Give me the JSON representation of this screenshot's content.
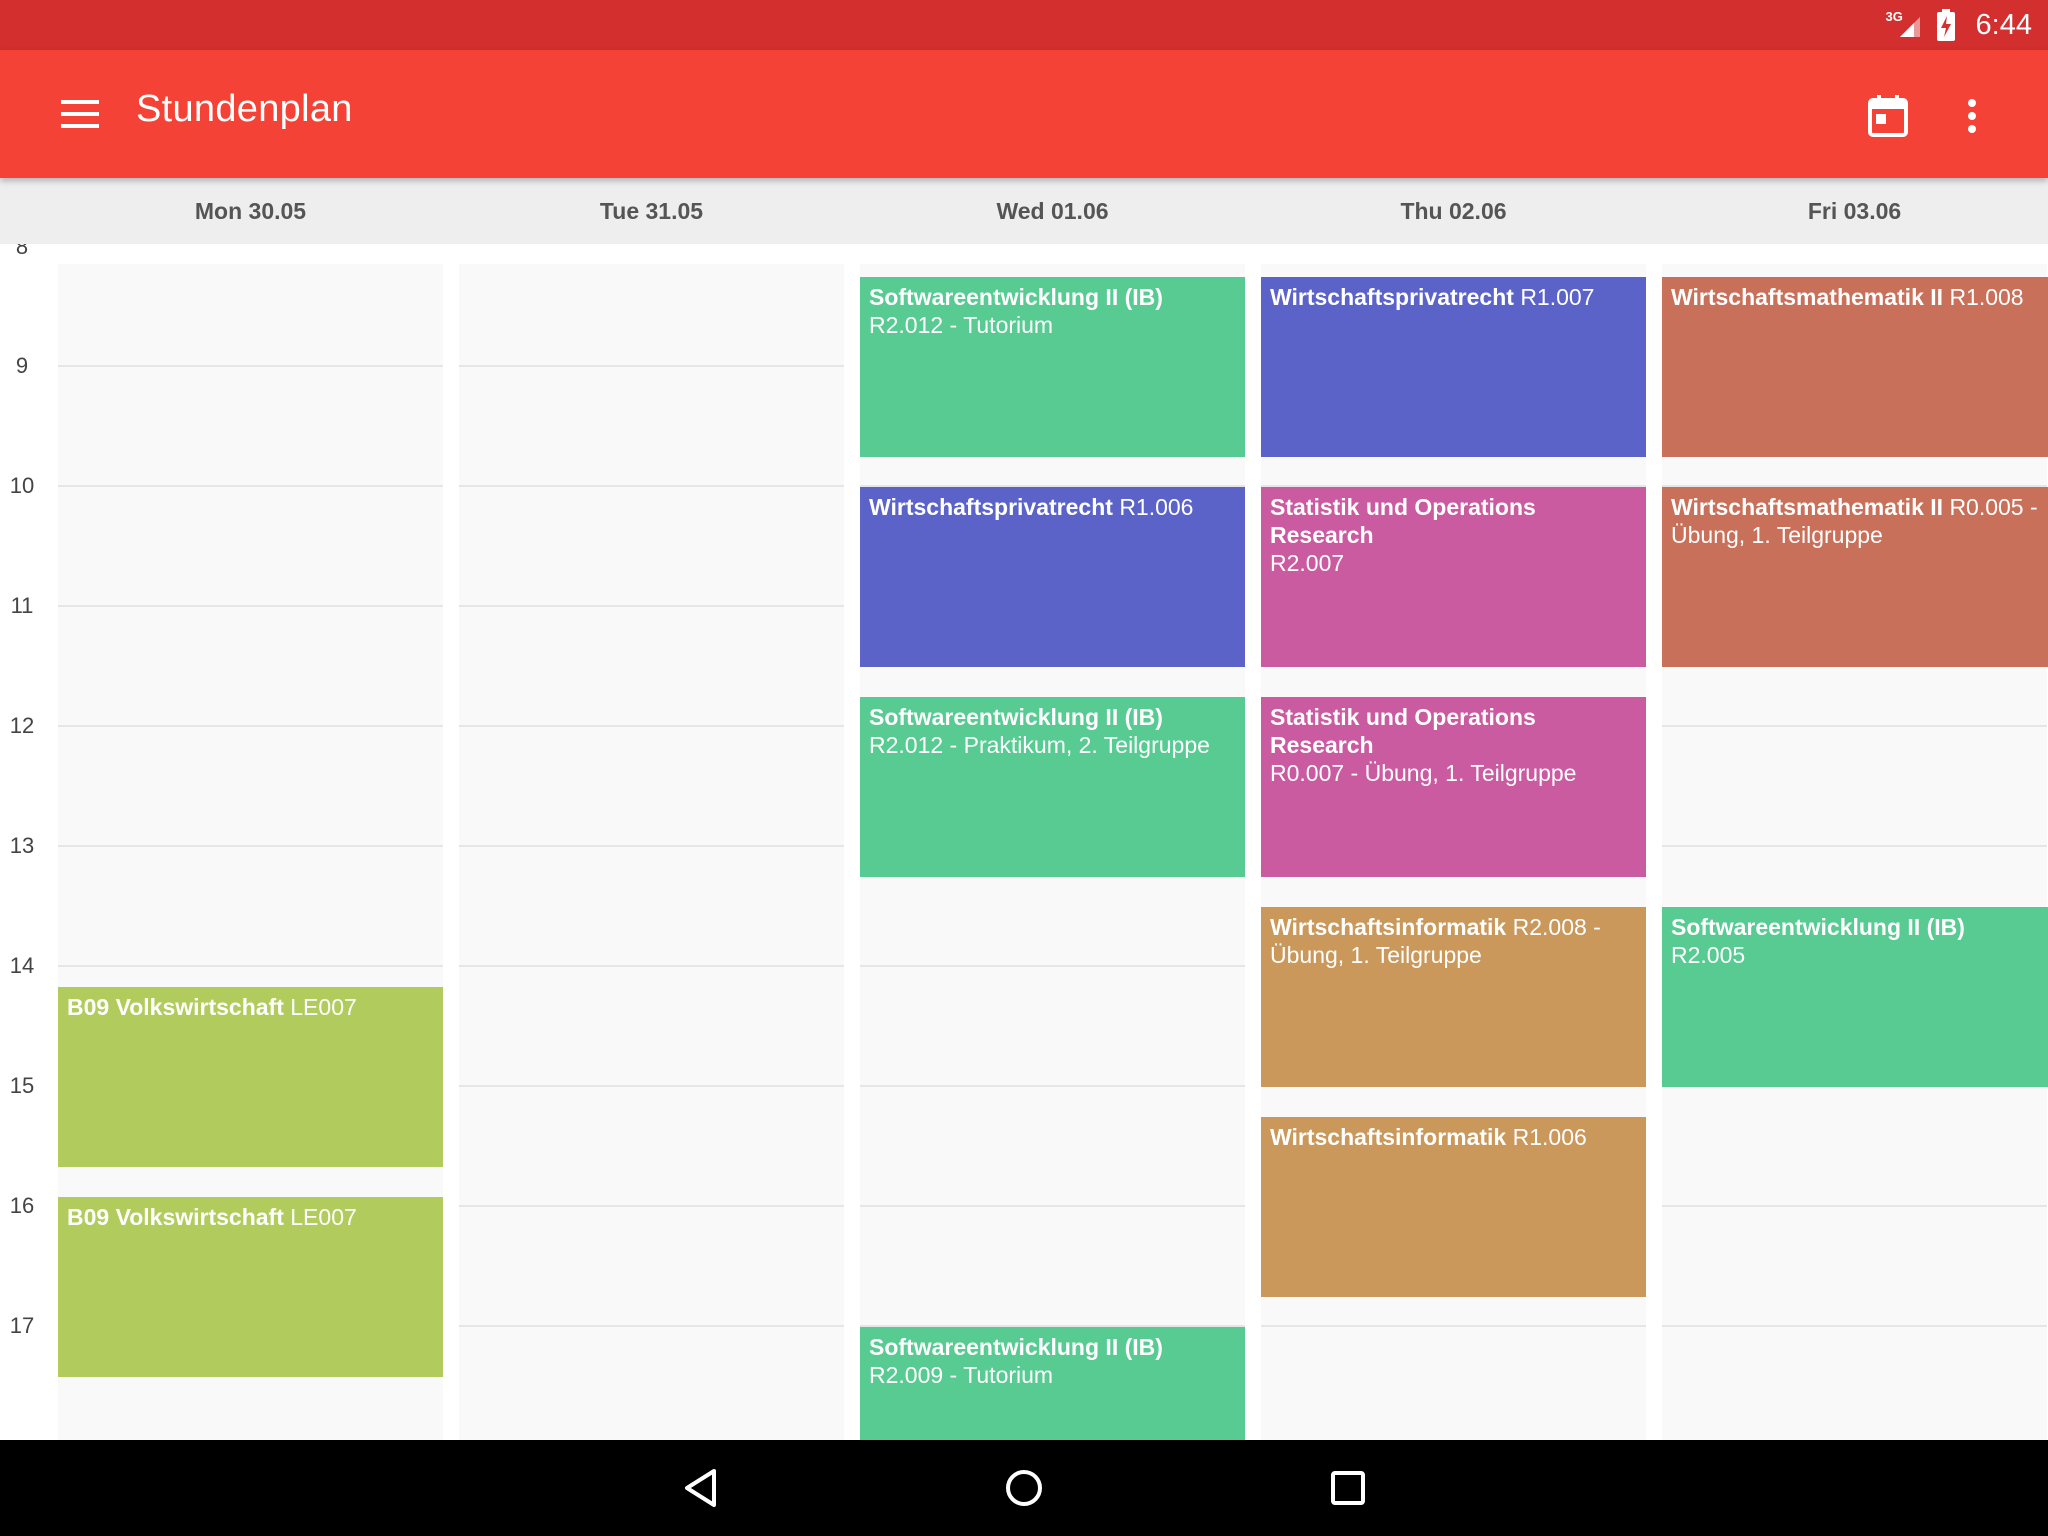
{
  "status_bar": {
    "network": "3G",
    "time": "6:44"
  },
  "app_bar": {
    "title": "Stundenplan",
    "icons": [
      "menu-icon",
      "calendar-today-icon",
      "more-vert-icon"
    ]
  },
  "days": [
    {
      "label": "Mon 30.05"
    },
    {
      "label": "Tue 31.05"
    },
    {
      "label": "Wed 01.06"
    },
    {
      "label": "Thu 02.06"
    },
    {
      "label": "Fri 03.06"
    }
  ],
  "hours": [
    "8",
    "9",
    "10",
    "11",
    "12",
    "13",
    "14",
    "15",
    "16",
    "17"
  ],
  "events": {
    "mon": [
      {
        "course": "B09 Volkswirtschaft",
        "room": "LE007",
        "start": "14:00",
        "end": "15:30"
      },
      {
        "course": "B09 Volkswirtschaft",
        "room": "LE007",
        "start": "15:45",
        "end": "17:15"
      }
    ],
    "wed": [
      {
        "course": "Softwareentwicklung II (IB)",
        "room": "R2.012 - Tutorium",
        "start": "8:15",
        "end": "9:45"
      },
      {
        "course": "Wirtschaftsprivatrecht",
        "room": "R1.006",
        "start": "10:00",
        "end": "11:30"
      },
      {
        "course": "Softwareentwicklung II (IB)",
        "room": "R2.012 - Praktikum, 2. Teilgruppe",
        "start": "11:45",
        "end": "13:15"
      },
      {
        "course": "Softwareentwicklung II (IB)",
        "room": "R2.009 - Tutorium",
        "start": "17:00",
        "end": "18:30"
      }
    ],
    "thu": [
      {
        "course": "Wirtschaftsprivatrecht",
        "room": "R1.007",
        "start": "8:15",
        "end": "9:45"
      },
      {
        "course": "Statistik und Operations Research",
        "room": "R2.007",
        "start": "10:00",
        "end": "11:30"
      },
      {
        "course": "Statistik und Operations Research",
        "room": "R0.007 - Übung, 1. Teilgruppe",
        "start": "11:45",
        "end": "13:15"
      },
      {
        "course": "Wirtschaftsinformatik",
        "room": "R2.008 - Übung, 1. Teilgruppe",
        "start": "13:30",
        "end": "15:00"
      },
      {
        "course": "Wirtschaftsinformatik",
        "room": "R1.006",
        "start": "15:15",
        "end": "16:45"
      }
    ],
    "fri": [
      {
        "course": "Wirtschaftsmathematik II",
        "room": "R1.008",
        "start": "8:15",
        "end": "9:45"
      },
      {
        "course": "Wirtschaftsmathematik II",
        "room": "R0.005 - Übung, 1. Teilgruppe",
        "start": "10:00",
        "end": "11:30"
      },
      {
        "course": "Softwareentwicklung II (IB)",
        "room": "R2.005",
        "start": "13:30",
        "end": "15:00"
      }
    ]
  },
  "colors": {
    "status_bar": "#d32f2f",
    "app_bar": "#f44336",
    "green": "#57cb92",
    "blue": "#5b63c9",
    "pink": "#cb5ba1",
    "terracotta": "#c9705a",
    "olive": "#b1cc5d",
    "orange": "#c9985a"
  },
  "nav_bar": {
    "icons": [
      "back-icon",
      "home-icon",
      "recents-icon"
    ]
  }
}
